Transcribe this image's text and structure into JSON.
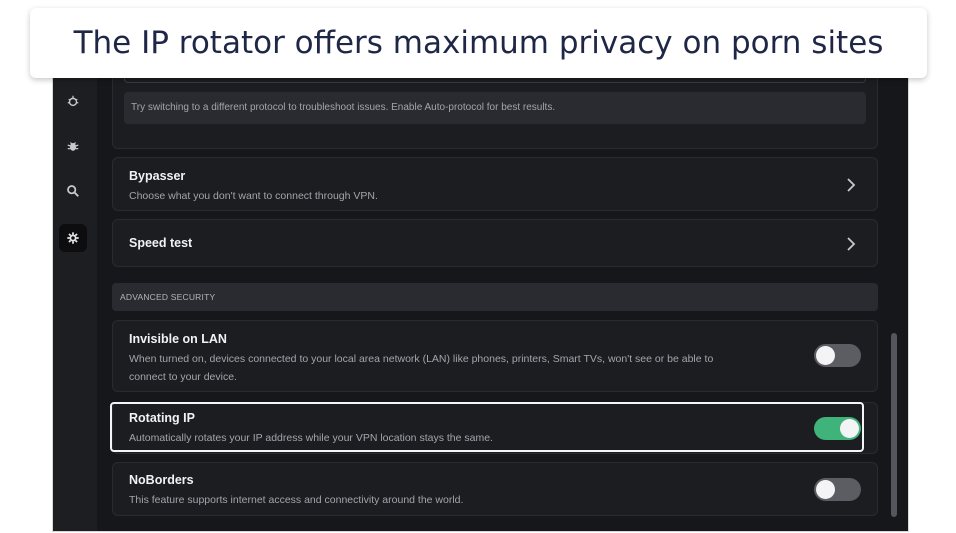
{
  "banner": {
    "title": "The IP rotator offers maximum privacy on porn sites"
  },
  "rail": {
    "icons": [
      "bug-shield-icon",
      "bug-icon",
      "search-icon",
      "gear-icon"
    ],
    "active": "gear-icon"
  },
  "protocol": {
    "hint": "Try switching to a different protocol to troubleshoot issues. Enable Auto-protocol for best results."
  },
  "bypasser": {
    "title": "Bypasser",
    "desc": "Choose what you don't want to connect through VPN."
  },
  "speed_test": {
    "title": "Speed test"
  },
  "advanced": {
    "heading": "ADVANCED SECURITY",
    "items": [
      {
        "title": "Invisible on LAN",
        "desc_line1": "When turned on, devices connected to your local area network (LAN) like phones, printers, Smart TVs, won't see or be able to",
        "desc_line2": "connect to your device.",
        "enabled": false
      },
      {
        "title": "Rotating IP",
        "desc_line1": "Automatically rotates your IP address while your VPN location stays the same.",
        "enabled": true
      },
      {
        "title": "NoBorders",
        "desc_line1": "This feature supports internet access and connectivity around the world.",
        "enabled": false
      }
    ]
  },
  "colors": {
    "toggle_on": "#3fb37a",
    "toggle_off": "#5c5d62",
    "background": "#16171b",
    "card": "#1c1d21",
    "banner_text": "#1f2747"
  }
}
